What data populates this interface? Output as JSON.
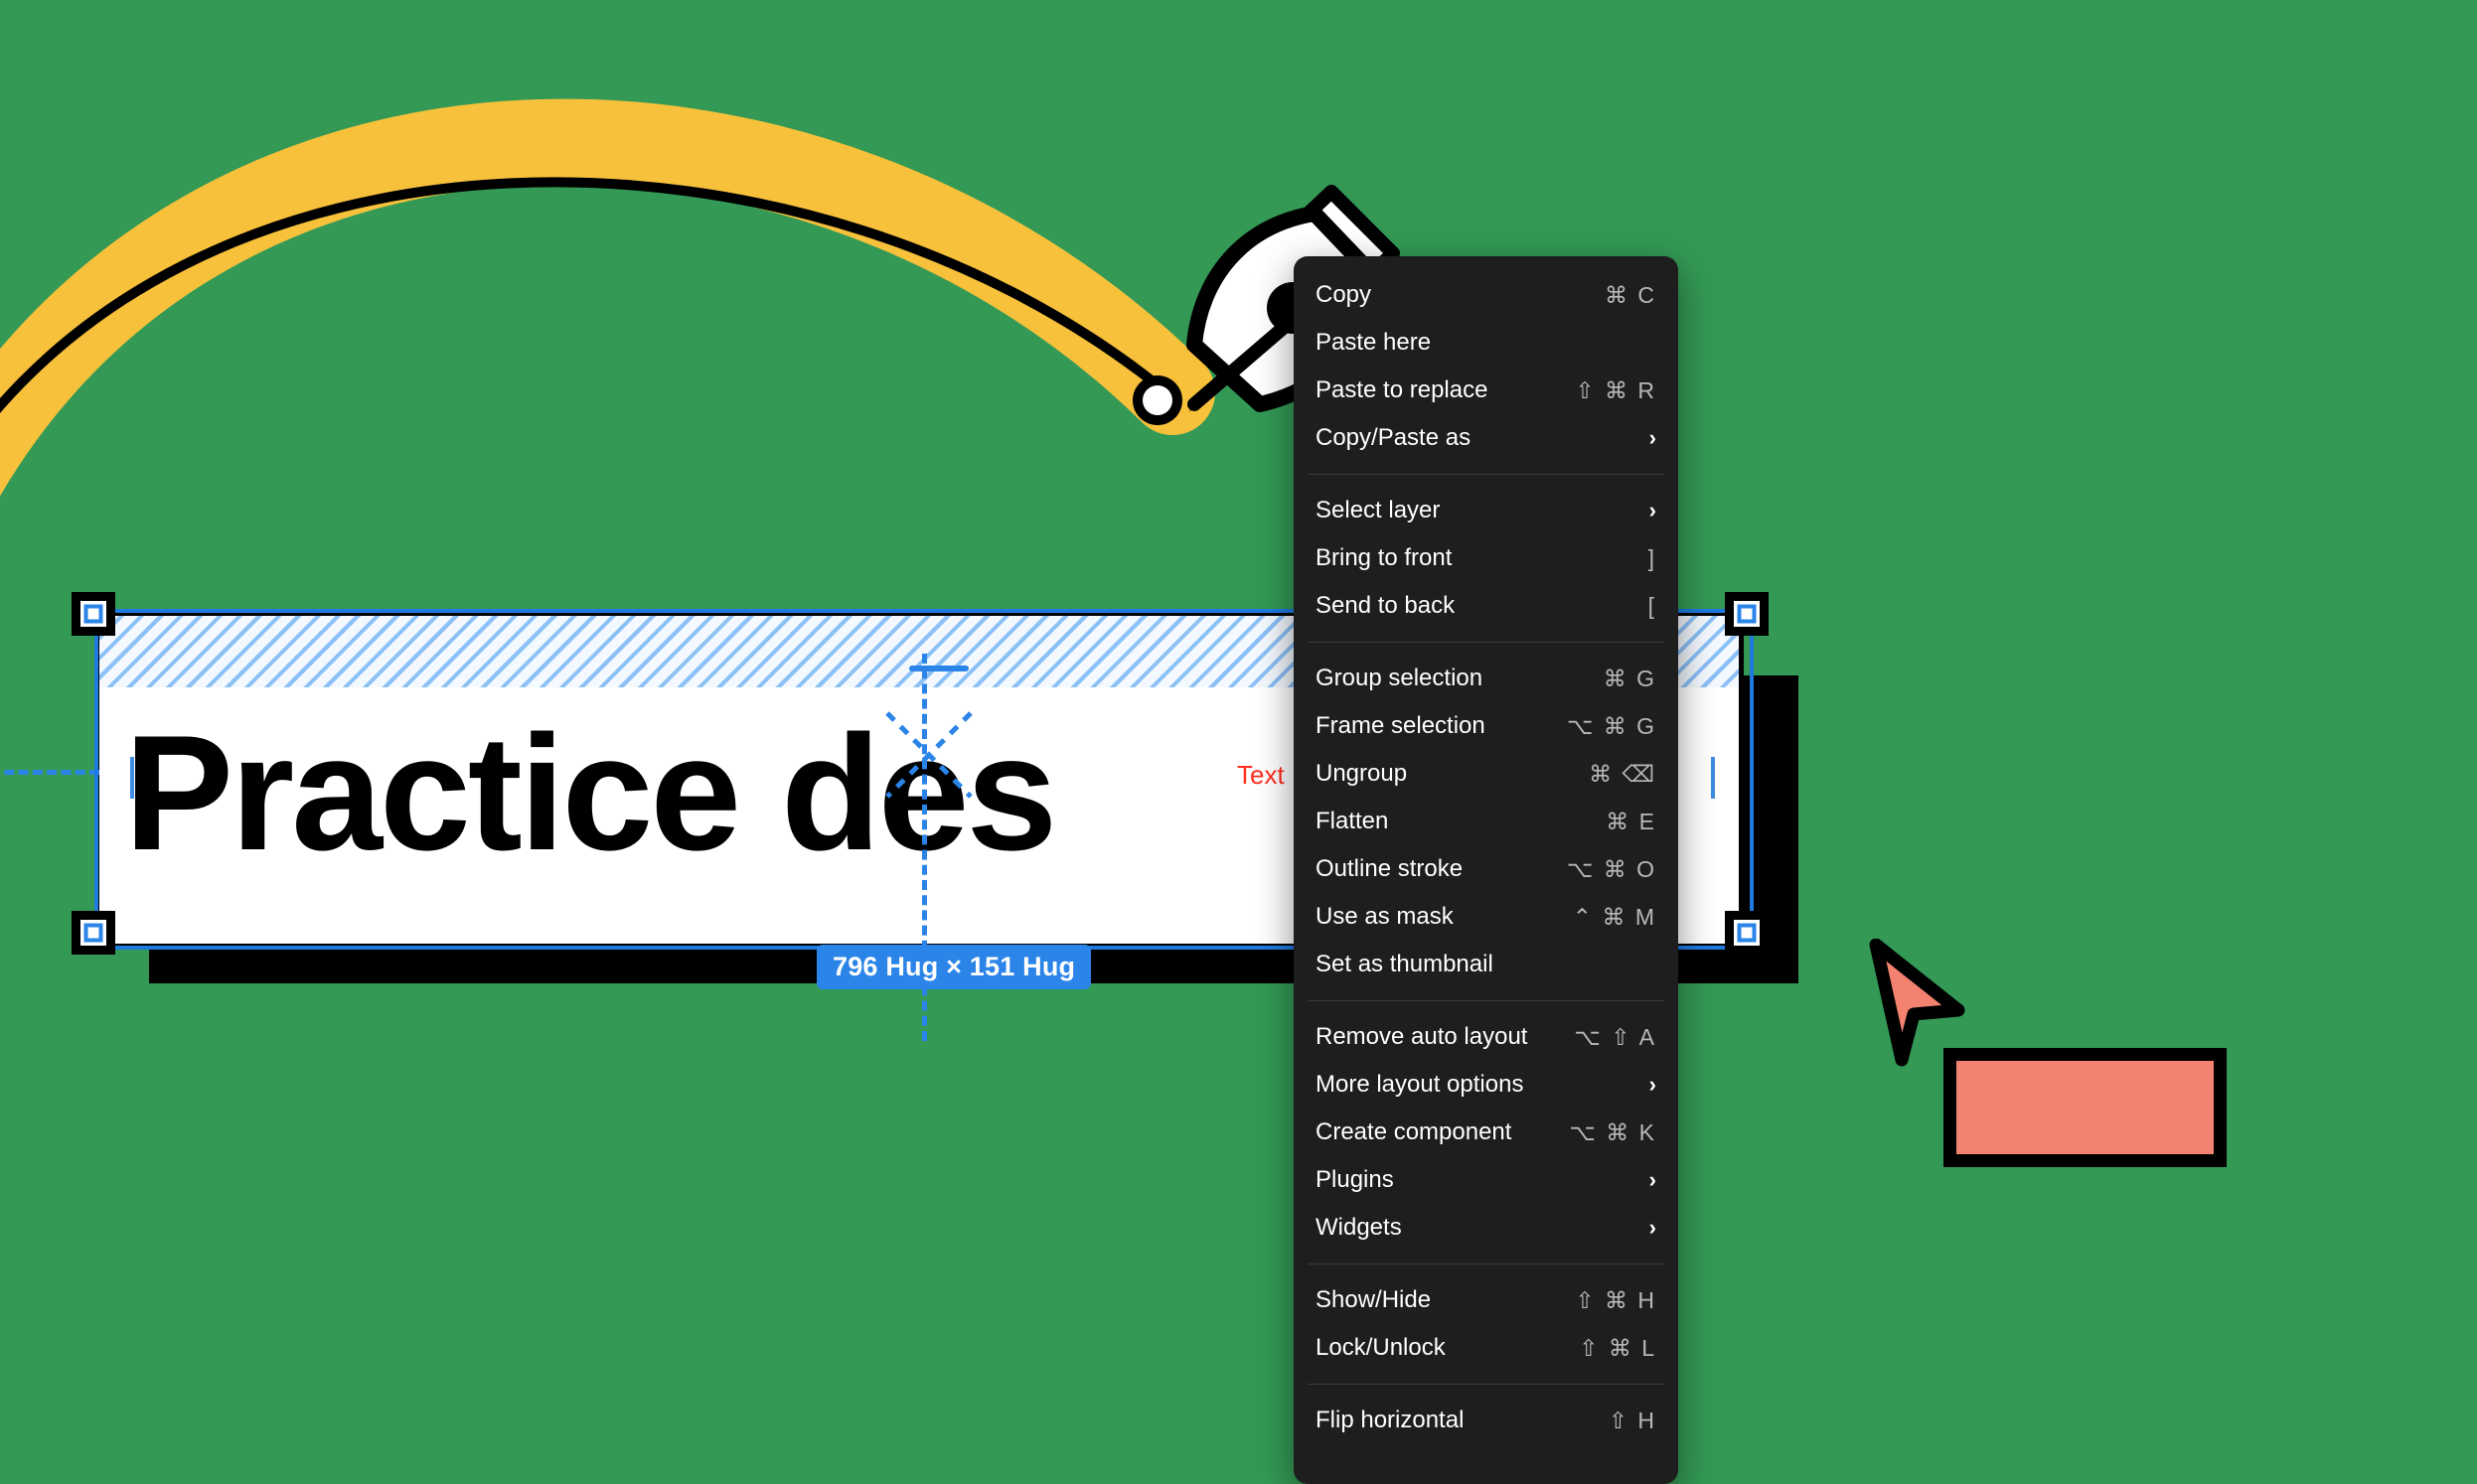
{
  "canvas": {
    "background_color": "#339955",
    "accent_yellow": "#F7C13C",
    "selection_blue": "#2b84e8",
    "salmon": "#F48270"
  },
  "text_layer": {
    "content": "Practice des",
    "layer_badge": "Text",
    "size_badge": "796 Hug × 151 Hug"
  },
  "context_menu": {
    "groups": [
      {
        "items": [
          {
            "label": "Copy",
            "shortcut": "⌘ C",
            "submenu": false
          },
          {
            "label": "Paste here",
            "shortcut": "",
            "submenu": false
          },
          {
            "label": "Paste to replace",
            "shortcut": "⇧ ⌘ R",
            "submenu": false
          },
          {
            "label": "Copy/Paste as",
            "shortcut": "",
            "submenu": true
          }
        ]
      },
      {
        "items": [
          {
            "label": "Select layer",
            "shortcut": "",
            "submenu": true
          },
          {
            "label": "Bring to front",
            "shortcut": "]",
            "submenu": false
          },
          {
            "label": "Send to back",
            "shortcut": "[",
            "submenu": false
          }
        ]
      },
      {
        "items": [
          {
            "label": "Group selection",
            "shortcut": "⌘ G",
            "submenu": false
          },
          {
            "label": "Frame selection",
            "shortcut": "⌥ ⌘ G",
            "submenu": false
          },
          {
            "label": "Ungroup",
            "shortcut": "⌘ ⌫",
            "submenu": false
          },
          {
            "label": "Flatten",
            "shortcut": "⌘ E",
            "submenu": false
          },
          {
            "label": "Outline stroke",
            "shortcut": "⌥ ⌘ O",
            "submenu": false
          },
          {
            "label": "Use as mask",
            "shortcut": "⌃ ⌘ M",
            "submenu": false
          },
          {
            "label": "Set as thumbnail",
            "shortcut": "",
            "submenu": false
          }
        ]
      },
      {
        "items": [
          {
            "label": "Remove auto layout",
            "shortcut": "⌥ ⇧ A",
            "submenu": false
          },
          {
            "label": "More layout options",
            "shortcut": "",
            "submenu": true
          },
          {
            "label": "Create component",
            "shortcut": "⌥ ⌘ K",
            "submenu": false
          },
          {
            "label": "Plugins",
            "shortcut": "",
            "submenu": true
          },
          {
            "label": "Widgets",
            "shortcut": "",
            "submenu": true
          }
        ]
      },
      {
        "items": [
          {
            "label": "Show/Hide",
            "shortcut": "⇧ ⌘ H",
            "submenu": false
          },
          {
            "label": "Lock/Unlock",
            "shortcut": "⇧ ⌘ L",
            "submenu": false
          }
        ]
      },
      {
        "items": [
          {
            "label": "Flip horizontal",
            "shortcut": "⇧ H",
            "submenu": false
          }
        ]
      }
    ]
  },
  "icons": {
    "pen_tool_cursor": "pen-tool-cursor-icon",
    "arrow_cursor": "arrow-cursor-icon",
    "path_anchor": "path-anchor-point-icon",
    "submenu_chevron": "chevron-right-icon"
  }
}
